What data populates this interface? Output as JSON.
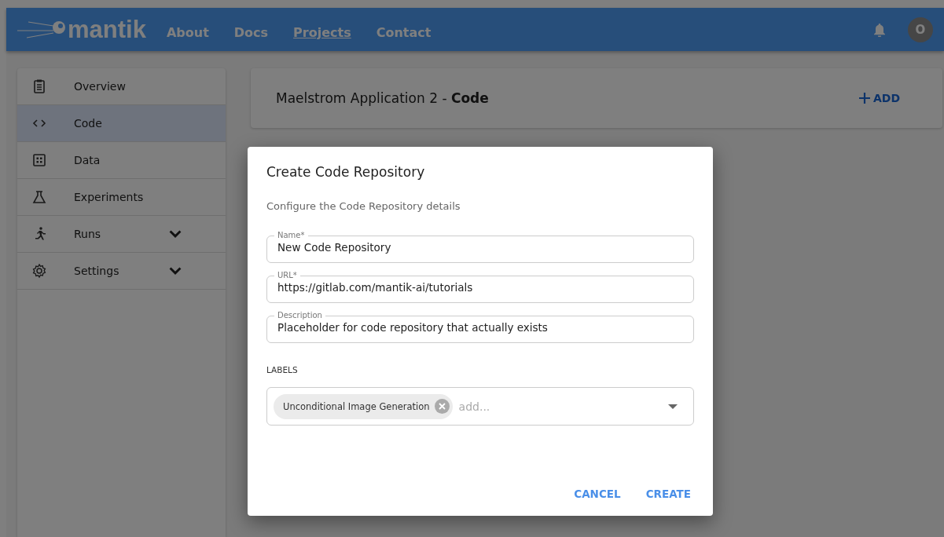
{
  "header": {
    "logo": "mantik",
    "nav": [
      {
        "label": "About",
        "selected": false
      },
      {
        "label": "Docs",
        "selected": false
      },
      {
        "label": "Projects",
        "selected": true
      },
      {
        "label": "Contact",
        "selected": false
      }
    ],
    "avatar": "O"
  },
  "sidebar": {
    "items": [
      {
        "label": "Overview",
        "selected": false
      },
      {
        "label": "Code",
        "selected": true
      },
      {
        "label": "Data",
        "selected": false
      },
      {
        "label": "Experiments",
        "selected": false
      },
      {
        "label": "Runs",
        "selected": false,
        "expanded": false
      },
      {
        "label": "Settings",
        "selected": false,
        "expanded": false
      }
    ]
  },
  "page_header": {
    "title": "Maelstrom Application 2 - **Code**",
    "add_button": "ADD"
  },
  "dialog": {
    "title": "Create Code Repository",
    "subtitle": "Configure the Code Repository details",
    "fields": [
      {
        "label": "Name*",
        "value": "New Code Repository"
      },
      {
        "label": "URL*",
        "value": "https://gitlab.com/mantik-ai/tutorials"
      },
      {
        "label": "Description",
        "value": "Placeholder for code repository that actually exists"
      }
    ],
    "labels_heading": "LABELS",
    "labels": [
      "Unconditional Image Generation"
    ],
    "labels_placeholder": "add...",
    "buttons": [
      "CANCEL",
      "CREATE"
    ]
  }
}
